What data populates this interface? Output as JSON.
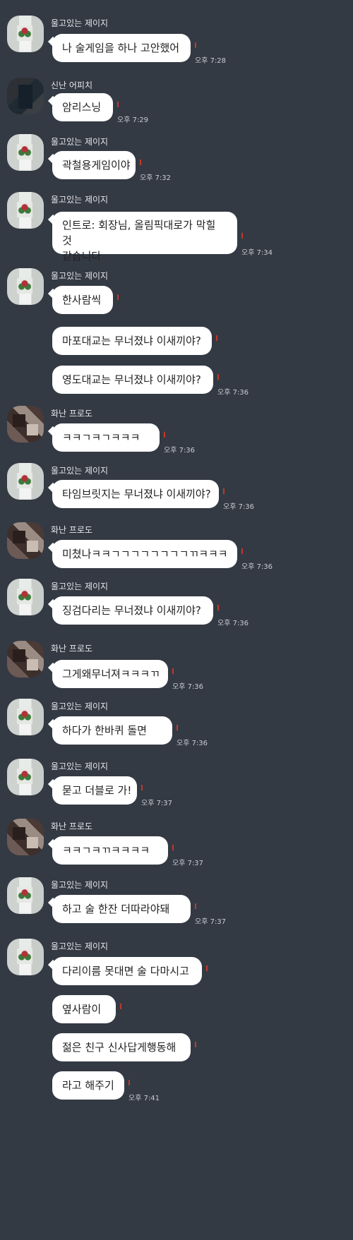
{
  "groups": [
    {
      "sender": "울고있는 제이지",
      "avatar": "pixel",
      "messages": [
        {
          "text": "나 술게임을 하나 고안했어",
          "time": "오후 7:28"
        }
      ]
    },
    {
      "sender": "신난 어피치",
      "avatar": "dark",
      "messages": [
        {
          "text": "암리스닝",
          "time": "오후 7:29"
        }
      ]
    },
    {
      "sender": "울고있는 제이지",
      "avatar": "pixel",
      "messages": [
        {
          "text": "곽철용게임이야",
          "time": "오후 7:32"
        }
      ]
    },
    {
      "sender": "울고있는 제이지",
      "avatar": "pixel",
      "messages": [
        {
          "text": "인트로: 회장님, 올림픽대로가 막힐 것\n같습니다",
          "time": "오후 7:34"
        }
      ]
    },
    {
      "sender": "울고있는 제이지",
      "avatar": "pixel",
      "messages": [
        {
          "text": "한사람씩",
          "time": ""
        },
        {
          "text": "마포대교는 무너졌냐 이새끼야?",
          "time": ""
        },
        {
          "text": "영도대교는 무너졌냐 이새끼야?",
          "time": "오후 7:36"
        }
      ]
    },
    {
      "sender": "화난 프로도",
      "avatar": "brown",
      "messages": [
        {
          "text": "ㅋㅋㄱㅋㄱㅋㅋㅋ",
          "time": "오후 7:36"
        }
      ]
    },
    {
      "sender": "울고있는 제이지",
      "avatar": "pixel",
      "messages": [
        {
          "text": "타임브릿지는 무너졌냐 이새끼야?",
          "time": "오후 7:36"
        }
      ]
    },
    {
      "sender": "화난 프로도",
      "avatar": "brown",
      "messages": [
        {
          "text": "미쳤나ㅋㅋㄱㄱㄱㄱㄱㄱㄱㄱㄲㅋㅋㅋ",
          "time": "오후 7:36"
        }
      ]
    },
    {
      "sender": "울고있는 제이지",
      "avatar": "pixel",
      "messages": [
        {
          "text": "징검다리는 무너졌냐 이새끼야?",
          "time": "오후 7:36"
        }
      ]
    },
    {
      "sender": "화난 프로도",
      "avatar": "brown",
      "messages": [
        {
          "text": "그게왜무너져ㅋㅋㅋㄲ",
          "time": "오후 7:36"
        }
      ]
    },
    {
      "sender": "울고있는 제이지",
      "avatar": "pixel",
      "messages": [
        {
          "text": "하다가 한바퀴 돌면",
          "time": "오후 7:36"
        }
      ]
    },
    {
      "sender": "울고있는 제이지",
      "avatar": "pixel",
      "messages": [
        {
          "text": "묻고 더블로 가!",
          "time": "오후 7:37"
        }
      ]
    },
    {
      "sender": "화난 프로도",
      "avatar": "brown",
      "messages": [
        {
          "text": "ㅋㅋㄱㅋㄲㅋㅋㅋㅋ",
          "time": "오후 7:37"
        }
      ]
    },
    {
      "sender": "울고있는 제이지",
      "avatar": "pixel",
      "messages": [
        {
          "text": "하고 술 한잔 더따라야돼",
          "time": "오후 7:37"
        }
      ]
    },
    {
      "sender": "울고있는 제이지",
      "avatar": "pixel",
      "messages": [
        {
          "text": "다리이름 못대면 술 다마시고",
          "time": ""
        },
        {
          "text": "옆사람이",
          "time": ""
        },
        {
          "text": "젊은 친구 신사답게행동해",
          "time": ""
        },
        {
          "text": "라고 해주기",
          "time": "오후 7:41"
        }
      ]
    }
  ]
}
